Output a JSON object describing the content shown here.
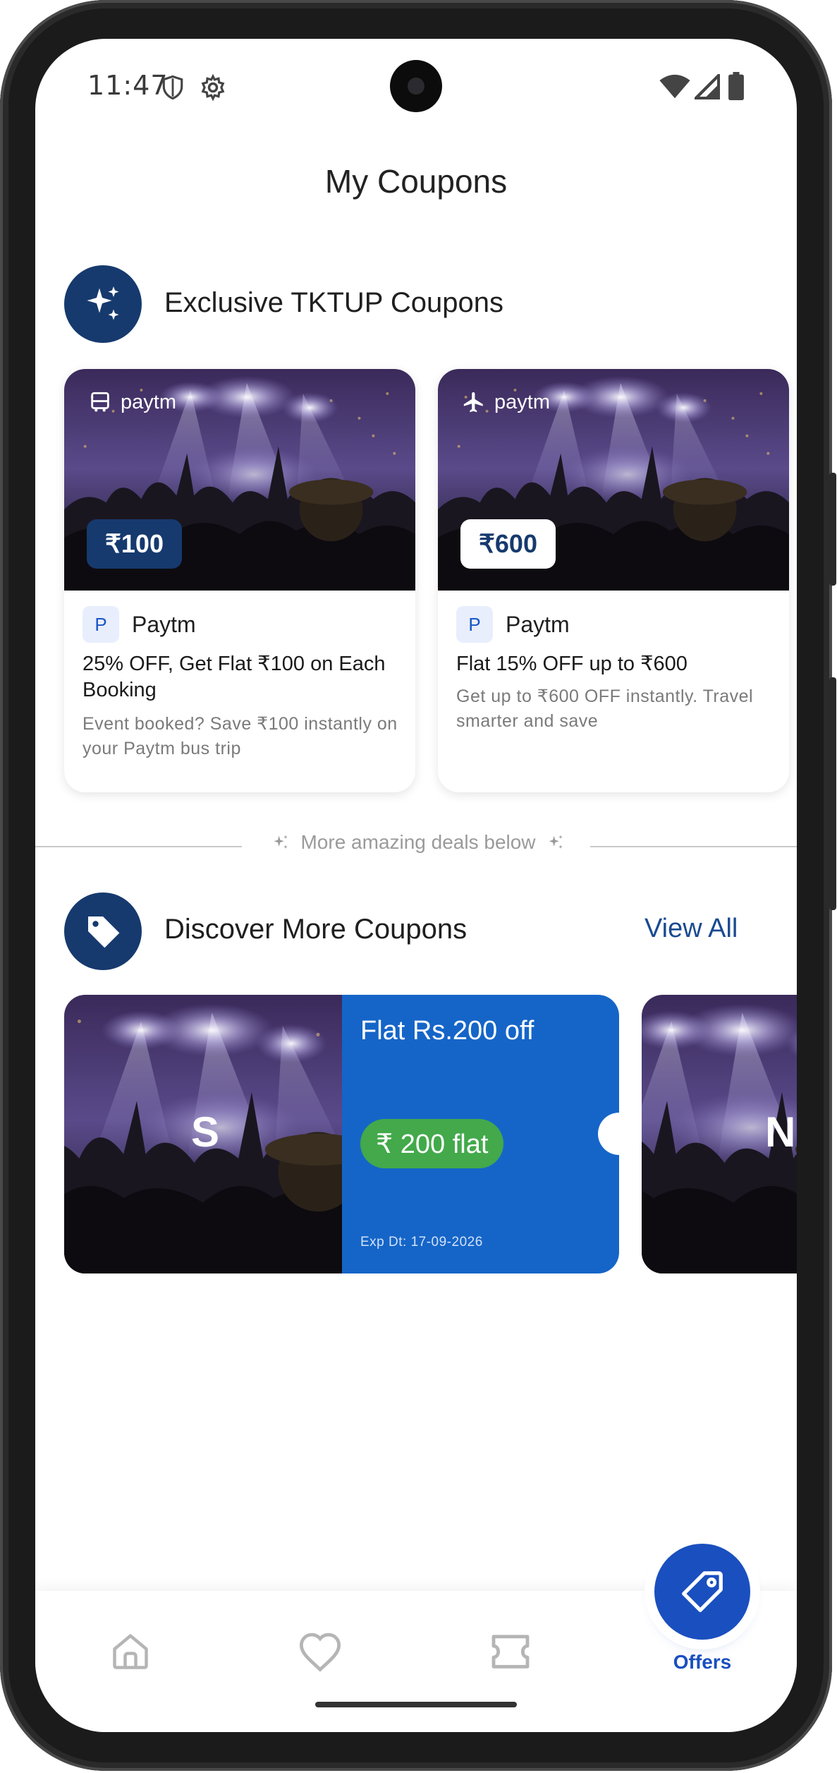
{
  "status_bar": {
    "time": "11:47",
    "icons_left": [
      "shield-icon",
      "settings-icon"
    ],
    "icons_right": [
      "wifi-icon",
      "signal-icon",
      "battery-icon"
    ]
  },
  "page": {
    "title": "My Coupons"
  },
  "exclusive": {
    "title": "Exclusive TKTUP Coupons",
    "icon": "sparkle-icon",
    "cards": [
      {
        "brand_top": "paytm",
        "brand_top_icon": "bus-icon",
        "amount": "₹100",
        "badge_style": "dark",
        "brand_initial": "P",
        "brand_name": "Paytm",
        "headline": "25% OFF, Get Flat ₹100 on Each Booking",
        "description": "Event booked? Save ₹100 instantly on your Paytm bus trip"
      },
      {
        "brand_top": "paytm",
        "brand_top_icon": "airplane-icon",
        "amount": "₹600",
        "badge_style": "light",
        "brand_initial": "P",
        "brand_name": "Paytm",
        "headline": "Flat 15% OFF up to ₹600",
        "description": "Get up to ₹600 OFF instantly. Travel smarter and save"
      }
    ]
  },
  "divider": {
    "text": "More amazing deals below"
  },
  "discover": {
    "title": "Discover More Coupons",
    "icon": "tag-icon",
    "view_all": "View All",
    "tickets": [
      {
        "initial": "S",
        "title": "Flat Rs.200 off",
        "pill": "₹ 200 flat",
        "expiry": "Exp Dt: 17-09-2026"
      },
      {
        "initial": "N"
      }
    ]
  },
  "bottom_nav": {
    "items": [
      {
        "icon": "home-icon"
      },
      {
        "icon": "heart-icon"
      },
      {
        "icon": "ticket-icon"
      },
      {
        "icon": "offers-tag-icon",
        "label": "Offers",
        "active": true
      }
    ]
  },
  "colors": {
    "brand_navy": "#163a6e",
    "ticket_blue": "#1565c8",
    "pill_green": "#43a94b",
    "active_blue": "#1a4fbf"
  }
}
